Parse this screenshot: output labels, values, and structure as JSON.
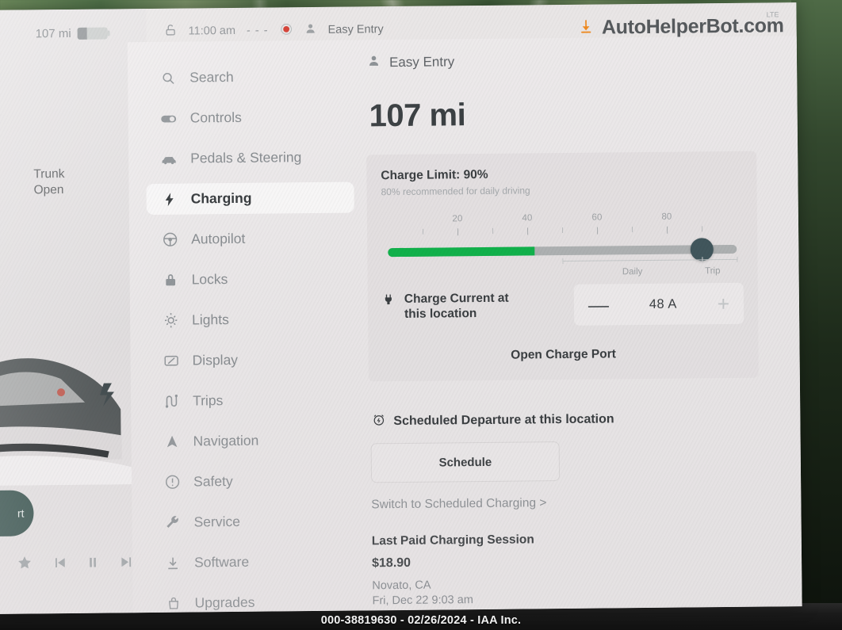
{
  "footer_caption": "000-38819630 - 02/26/2024 - IAA Inc.",
  "status_bar": {
    "range": "107 mi",
    "lock_icon": "unlock-icon",
    "time": "11:00 am",
    "temp": "- - -",
    "record_icon": "record-indicator",
    "profile_icon": "person-icon",
    "profile_name": "Easy Entry",
    "network": "LTE",
    "watermark": "AutoHelperBot.com",
    "watermark_icon": "download-icon"
  },
  "left_panel": {
    "trunk_status_line1": "Trunk",
    "trunk_status_line2": "Open",
    "start_pill_label": "rt",
    "media": [
      {
        "name": "favorite-icon",
        "glyph": "★"
      },
      {
        "name": "previous-icon",
        "glyph": "⏮"
      },
      {
        "name": "pause-icon",
        "glyph": "⏸"
      },
      {
        "name": "next-icon",
        "glyph": "⏭"
      }
    ]
  },
  "sidebar": {
    "items": [
      {
        "label": "Search",
        "icon": "search-icon",
        "active": false
      },
      {
        "label": "Controls",
        "icon": "toggle-icon",
        "active": false
      },
      {
        "label": "Pedals & Steering",
        "icon": "car-icon",
        "active": false
      },
      {
        "label": "Charging",
        "icon": "lightning-bolt-icon",
        "active": true
      },
      {
        "label": "Autopilot",
        "icon": "steering-wheel-icon",
        "active": false
      },
      {
        "label": "Locks",
        "icon": "padlock-icon",
        "active": false
      },
      {
        "label": "Lights",
        "icon": "sun-icon",
        "active": false
      },
      {
        "label": "Display",
        "icon": "display-icon",
        "active": false
      },
      {
        "label": "Trips",
        "icon": "trips-icon",
        "active": false
      },
      {
        "label": "Navigation",
        "icon": "navigation-arrow-icon",
        "active": false
      },
      {
        "label": "Safety",
        "icon": "alert-circle-icon",
        "active": false
      },
      {
        "label": "Service",
        "icon": "wrench-icon",
        "active": false
      },
      {
        "label": "Software",
        "icon": "download-arrow-icon",
        "active": false
      },
      {
        "label": "Upgrades",
        "icon": "bag-icon",
        "active": false
      }
    ]
  },
  "main": {
    "profile_name": "Easy Entry",
    "range_big": "107 mi",
    "charge_limit_title": "Charge Limit: 90%",
    "charge_limit_sub": "80% recommended for daily driving",
    "current_label_line1": "Charge Current at",
    "current_label_line2": "this location",
    "current_value": "48 A",
    "minus_label": "—",
    "plus_label": "+",
    "open_charge_port": "Open Charge Port",
    "scheduled_departure": "Scheduled Departure at this location",
    "schedule_button": "Schedule",
    "switch_link": "Switch to Scheduled Charging >",
    "last_session_title": "Last Paid Charging Session",
    "last_session_amount": "$18.90",
    "last_session_place": "Novato, CA",
    "last_session_when": "Fri, Dec 22 9:03 am"
  },
  "chart_data": {
    "type": "slider",
    "title": "Charge Limit",
    "value": 90,
    "unit": "%",
    "xlim": [
      0,
      100
    ],
    "tick_labels": [
      {
        "value": 20,
        "label": "20"
      },
      {
        "value": 40,
        "label": "40"
      },
      {
        "value": 60,
        "label": "60"
      },
      {
        "value": 80,
        "label": "80"
      }
    ],
    "minor_ticks": [
      10,
      20,
      30,
      40,
      50,
      60,
      70,
      80,
      90
    ],
    "fill_color": "#11b14b",
    "track_color": "#adb0b1",
    "thumb_color": "#41565c",
    "fill_percent": 42,
    "ranges": [
      {
        "name": "Daily",
        "from": 50,
        "to": 90,
        "center": 70
      },
      {
        "name": "Trip",
        "from": 90,
        "to": 100,
        "center": 93
      }
    ]
  },
  "colors": {
    "accent_green": "#11b14b",
    "accent_orange": "#ef8b22",
    "panel_bg": "#e8e5e6",
    "card_bg": "#e0dde0",
    "text_primary": "#3a3e41",
    "text_muted": "#8a8e92",
    "thumb": "#41565c"
  }
}
